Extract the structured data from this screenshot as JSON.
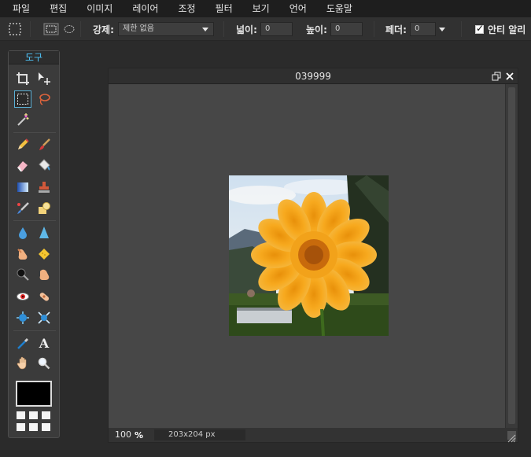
{
  "menu": {
    "items": [
      "파일",
      "편집",
      "이미지",
      "레이어",
      "조정",
      "필터",
      "보기",
      "언어",
      "도움말"
    ]
  },
  "options": {
    "constraint_label": "강제:",
    "constraint_value": "제한 없음",
    "width_label": "넓이:",
    "width_value": "0",
    "height_label": "높이:",
    "height_value": "0",
    "feather_label": "페더:",
    "feather_value": "0",
    "antialias_label": "안티 알리",
    "antialias_checked": true
  },
  "tools": {
    "header": "도구",
    "foreground_color": "#000000"
  },
  "document": {
    "title": "039999",
    "zoom_value": "100",
    "zoom_unit": "%",
    "dimensions": "203x204 px"
  },
  "colors": {
    "accent": "#4fc3f7",
    "flower": "#f5a623",
    "flower_center": "#c86a0c"
  }
}
